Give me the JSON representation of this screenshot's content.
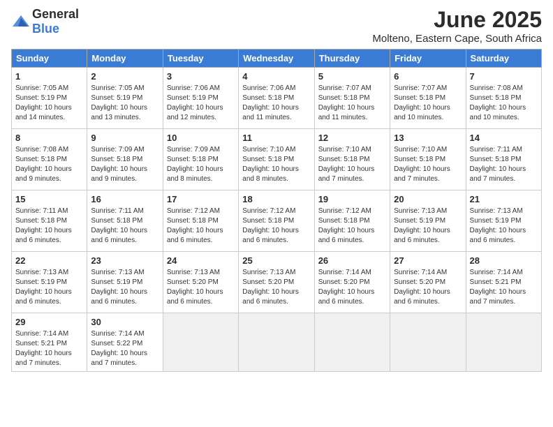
{
  "header": {
    "logo_general": "General",
    "logo_blue": "Blue",
    "month_title": "June 2025",
    "subtitle": "Molteno, Eastern Cape, South Africa"
  },
  "weekdays": [
    "Sunday",
    "Monday",
    "Tuesday",
    "Wednesday",
    "Thursday",
    "Friday",
    "Saturday"
  ],
  "weeks": [
    [
      {
        "day": "1",
        "info": "Sunrise: 7:05 AM\nSunset: 5:19 PM\nDaylight: 10 hours\nand 14 minutes."
      },
      {
        "day": "2",
        "info": "Sunrise: 7:05 AM\nSunset: 5:19 PM\nDaylight: 10 hours\nand 13 minutes."
      },
      {
        "day": "3",
        "info": "Sunrise: 7:06 AM\nSunset: 5:19 PM\nDaylight: 10 hours\nand 12 minutes."
      },
      {
        "day": "4",
        "info": "Sunrise: 7:06 AM\nSunset: 5:18 PM\nDaylight: 10 hours\nand 11 minutes."
      },
      {
        "day": "5",
        "info": "Sunrise: 7:07 AM\nSunset: 5:18 PM\nDaylight: 10 hours\nand 11 minutes."
      },
      {
        "day": "6",
        "info": "Sunrise: 7:07 AM\nSunset: 5:18 PM\nDaylight: 10 hours\nand 10 minutes."
      },
      {
        "day": "7",
        "info": "Sunrise: 7:08 AM\nSunset: 5:18 PM\nDaylight: 10 hours\nand 10 minutes."
      }
    ],
    [
      {
        "day": "8",
        "info": "Sunrise: 7:08 AM\nSunset: 5:18 PM\nDaylight: 10 hours\nand 9 minutes."
      },
      {
        "day": "9",
        "info": "Sunrise: 7:09 AM\nSunset: 5:18 PM\nDaylight: 10 hours\nand 9 minutes."
      },
      {
        "day": "10",
        "info": "Sunrise: 7:09 AM\nSunset: 5:18 PM\nDaylight: 10 hours\nand 8 minutes."
      },
      {
        "day": "11",
        "info": "Sunrise: 7:10 AM\nSunset: 5:18 PM\nDaylight: 10 hours\nand 8 minutes."
      },
      {
        "day": "12",
        "info": "Sunrise: 7:10 AM\nSunset: 5:18 PM\nDaylight: 10 hours\nand 7 minutes."
      },
      {
        "day": "13",
        "info": "Sunrise: 7:10 AM\nSunset: 5:18 PM\nDaylight: 10 hours\nand 7 minutes."
      },
      {
        "day": "14",
        "info": "Sunrise: 7:11 AM\nSunset: 5:18 PM\nDaylight: 10 hours\nand 7 minutes."
      }
    ],
    [
      {
        "day": "15",
        "info": "Sunrise: 7:11 AM\nSunset: 5:18 PM\nDaylight: 10 hours\nand 6 minutes."
      },
      {
        "day": "16",
        "info": "Sunrise: 7:11 AM\nSunset: 5:18 PM\nDaylight: 10 hours\nand 6 minutes."
      },
      {
        "day": "17",
        "info": "Sunrise: 7:12 AM\nSunset: 5:18 PM\nDaylight: 10 hours\nand 6 minutes."
      },
      {
        "day": "18",
        "info": "Sunrise: 7:12 AM\nSunset: 5:18 PM\nDaylight: 10 hours\nand 6 minutes."
      },
      {
        "day": "19",
        "info": "Sunrise: 7:12 AM\nSunset: 5:18 PM\nDaylight: 10 hours\nand 6 minutes."
      },
      {
        "day": "20",
        "info": "Sunrise: 7:13 AM\nSunset: 5:19 PM\nDaylight: 10 hours\nand 6 minutes."
      },
      {
        "day": "21",
        "info": "Sunrise: 7:13 AM\nSunset: 5:19 PM\nDaylight: 10 hours\nand 6 minutes."
      }
    ],
    [
      {
        "day": "22",
        "info": "Sunrise: 7:13 AM\nSunset: 5:19 PM\nDaylight: 10 hours\nand 6 minutes."
      },
      {
        "day": "23",
        "info": "Sunrise: 7:13 AM\nSunset: 5:19 PM\nDaylight: 10 hours\nand 6 minutes."
      },
      {
        "day": "24",
        "info": "Sunrise: 7:13 AM\nSunset: 5:20 PM\nDaylight: 10 hours\nand 6 minutes."
      },
      {
        "day": "25",
        "info": "Sunrise: 7:13 AM\nSunset: 5:20 PM\nDaylight: 10 hours\nand 6 minutes."
      },
      {
        "day": "26",
        "info": "Sunrise: 7:14 AM\nSunset: 5:20 PM\nDaylight: 10 hours\nand 6 minutes."
      },
      {
        "day": "27",
        "info": "Sunrise: 7:14 AM\nSunset: 5:20 PM\nDaylight: 10 hours\nand 6 minutes."
      },
      {
        "day": "28",
        "info": "Sunrise: 7:14 AM\nSunset: 5:21 PM\nDaylight: 10 hours\nand 7 minutes."
      }
    ],
    [
      {
        "day": "29",
        "info": "Sunrise: 7:14 AM\nSunset: 5:21 PM\nDaylight: 10 hours\nand 7 minutes."
      },
      {
        "day": "30",
        "info": "Sunrise: 7:14 AM\nSunset: 5:22 PM\nDaylight: 10 hours\nand 7 minutes."
      },
      {
        "day": "",
        "info": ""
      },
      {
        "day": "",
        "info": ""
      },
      {
        "day": "",
        "info": ""
      },
      {
        "day": "",
        "info": ""
      },
      {
        "day": "",
        "info": ""
      }
    ]
  ]
}
